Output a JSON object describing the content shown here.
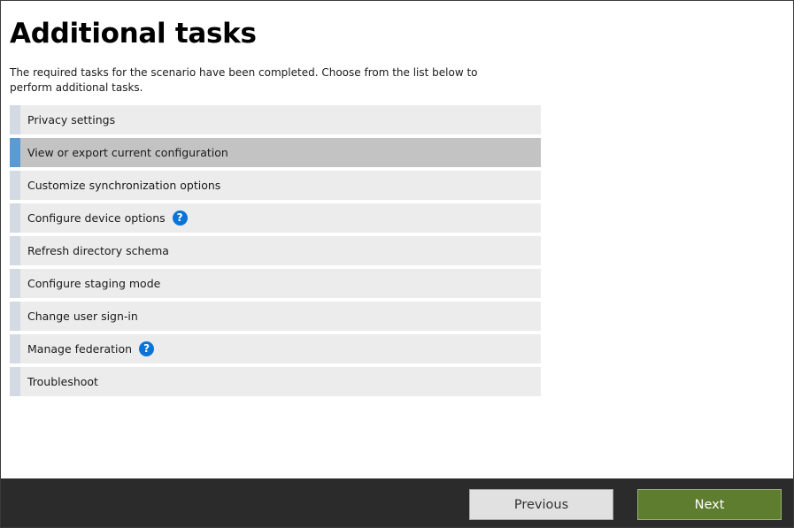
{
  "page": {
    "title": "Additional tasks",
    "description": "The required tasks for the scenario have been completed. Choose from the list below to perform additional tasks."
  },
  "tasks": [
    {
      "label": "Privacy settings",
      "selected": false,
      "help": false
    },
    {
      "label": "View or export current configuration",
      "selected": true,
      "help": false
    },
    {
      "label": "Customize synchronization options",
      "selected": false,
      "help": false
    },
    {
      "label": "Configure device options",
      "selected": false,
      "help": true
    },
    {
      "label": "Refresh directory schema",
      "selected": false,
      "help": false
    },
    {
      "label": "Configure staging mode",
      "selected": false,
      "help": false
    },
    {
      "label": "Change user sign-in",
      "selected": false,
      "help": false
    },
    {
      "label": "Manage federation",
      "selected": false,
      "help": true
    },
    {
      "label": "Troubleshoot",
      "selected": false,
      "help": false
    }
  ],
  "help_icon_glyph": "?",
  "footer": {
    "previous_label": "Previous",
    "next_label": "Next"
  },
  "colors": {
    "selected_accent": "#5b9bd5",
    "next_button": "#5e7d2e",
    "help_icon": "#0a74d6",
    "footer_bg": "#2b2b2b"
  }
}
